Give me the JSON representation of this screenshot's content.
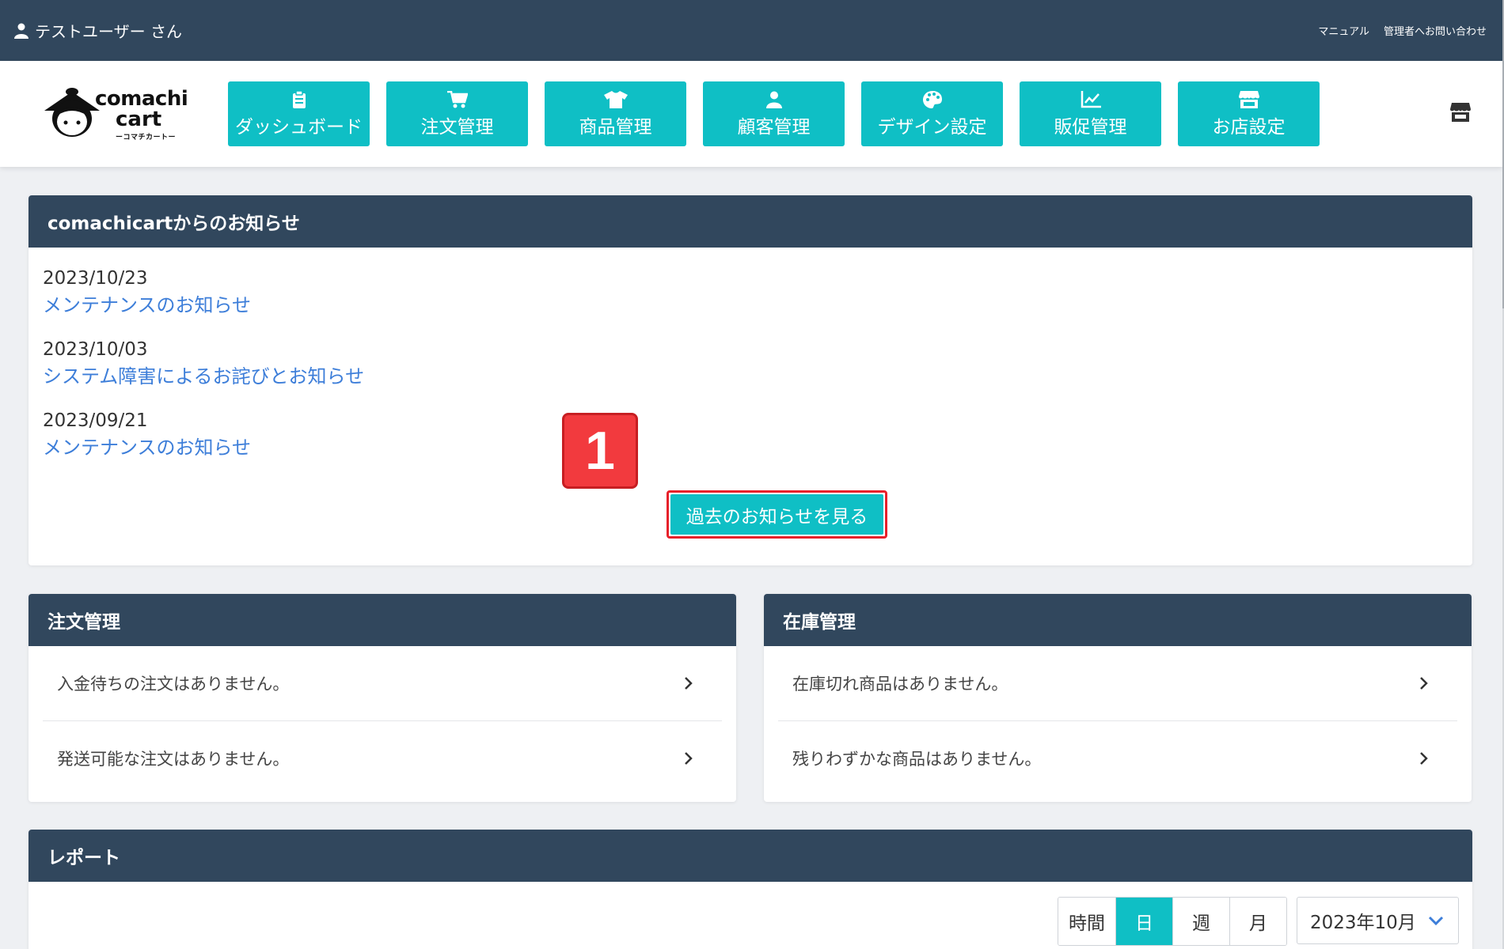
{
  "topbar": {
    "user_name": "テストユーザー さん",
    "links": [
      "マニュアル",
      "管理者へお問い合わせ"
    ]
  },
  "logo": {
    "word1": "comachi",
    "word2": "cart",
    "kana": "ーコマチカートー"
  },
  "nav": [
    {
      "label": "ダッシュボード",
      "icon": "clipboard-icon"
    },
    {
      "label": "注文管理",
      "icon": "cart-icon"
    },
    {
      "label": "商品管理",
      "icon": "tshirt-icon"
    },
    {
      "label": "顧客管理",
      "icon": "user-icon"
    },
    {
      "label": "デザイン設定",
      "icon": "palette-icon"
    },
    {
      "label": "販促管理",
      "icon": "chart-line-icon"
    },
    {
      "label": "お店設定",
      "icon": "store-icon"
    }
  ],
  "news": {
    "title": "comachicartからのお知らせ",
    "items": [
      {
        "date": "2023/10/23",
        "title": "メンテナンスのお知らせ"
      },
      {
        "date": "2023/10/03",
        "title": "システム障害によるお詫びとお知らせ"
      },
      {
        "date": "2023/09/21",
        "title": "メンテナンスのお知らせ"
      }
    ],
    "more_label": "過去のお知らせを見る",
    "callout": "1"
  },
  "orders": {
    "title": "注文管理",
    "rows": [
      "入金待ちの注文はありません。",
      "発送可能な注文はありません。"
    ]
  },
  "stock": {
    "title": "在庫管理",
    "rows": [
      "在庫切れ商品はありません。",
      "残りわずかな商品はありません。"
    ]
  },
  "report": {
    "title": "レポート",
    "periods": [
      "時間",
      "日",
      "週",
      "月"
    ],
    "active_period": "日",
    "month": "2023年10月"
  },
  "colors": {
    "navy": "#31475d",
    "teal": "#0fbfc5",
    "link": "#3d7ed9",
    "highlight": "#e8212a"
  }
}
